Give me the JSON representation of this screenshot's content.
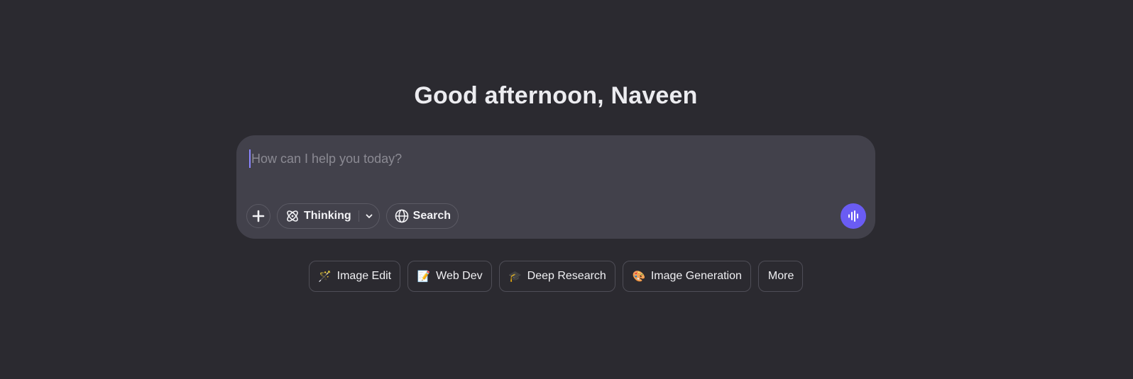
{
  "greeting": "Good afternoon, Naveen",
  "composer": {
    "placeholder": "How can I help you today?",
    "value": "",
    "attach_icon": "plus-icon",
    "thinking": {
      "label": "Thinking",
      "icon": "atom-icon",
      "dropdown_icon": "chevron-down-icon"
    },
    "search": {
      "label": "Search",
      "icon": "globe-icon"
    },
    "voice_icon": "audio-waveform-icon",
    "accent_color": "#6a5cf3"
  },
  "suggestions": [
    {
      "emoji": "🪄",
      "label": "Image Edit"
    },
    {
      "emoji": "📝",
      "label": "Web Dev"
    },
    {
      "emoji": "🎓",
      "label": "Deep Research"
    },
    {
      "emoji": "🎨",
      "label": "Image Generation"
    },
    {
      "emoji": "",
      "label": "More"
    }
  ]
}
